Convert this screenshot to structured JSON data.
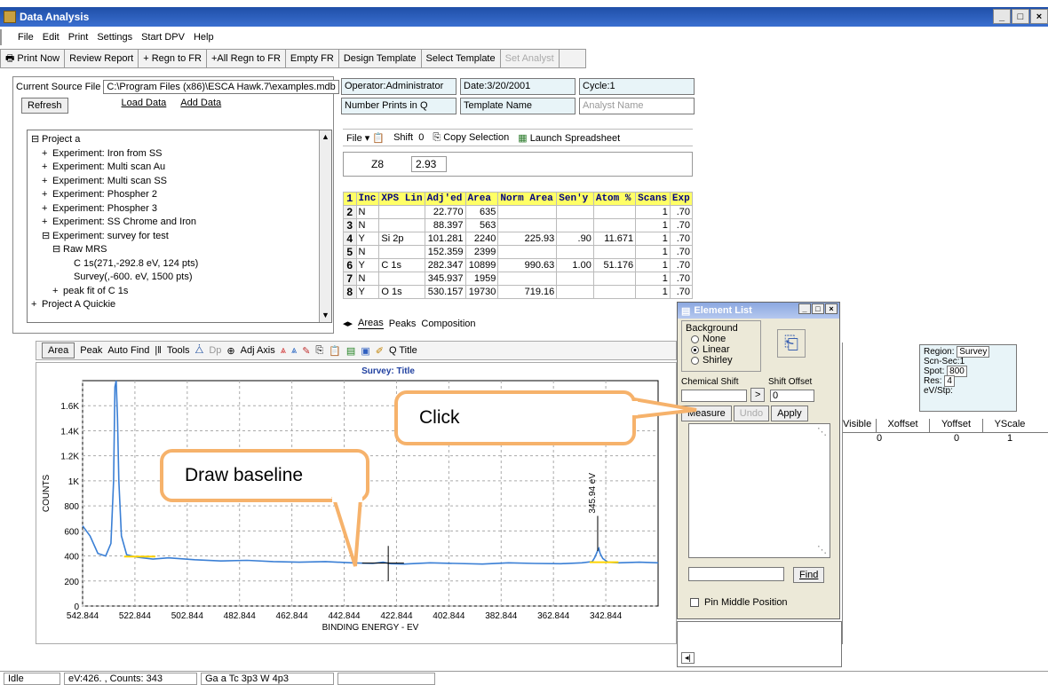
{
  "window": {
    "title": "Data Analysis",
    "controls": [
      "_",
      "□",
      "×"
    ]
  },
  "menu": [
    "File",
    "Edit",
    "Print",
    "Settings",
    "Start DPV",
    "Help"
  ],
  "toolbar": [
    {
      "label": "Print Now",
      "icon": "printer-icon",
      "disabled": false
    },
    {
      "label": "Review Report",
      "disabled": false
    },
    {
      "label": "+ Regn to FR",
      "disabled": false
    },
    {
      "label": "+All Regn to FR",
      "disabled": false
    },
    {
      "label": "Empty FR",
      "disabled": false
    },
    {
      "label": "Design Template",
      "disabled": false
    },
    {
      "label": "Select Template",
      "disabled": false
    },
    {
      "label": "Set Analyst",
      "disabled": true
    }
  ],
  "source": {
    "label": "Current Source File",
    "path": "C:\\Program Files (x86)\\ESCA Hawk.7\\examples.mdb",
    "refresh": "Refresh",
    "load": "Load Data",
    "add": "Add Data"
  },
  "info": {
    "operator": "Operator:Administrator",
    "date": "Date:3/20/2001",
    "cycle": "Cycle:1",
    "prints": "Number Prints in Q",
    "template": "Template Name",
    "analyst": "Analyst Name"
  },
  "tree": [
    {
      "indent": 0,
      "sign": "⊟",
      "text": "Project a"
    },
    {
      "indent": 1,
      "sign": "+",
      "text": "Experiment: Iron from SS"
    },
    {
      "indent": 1,
      "sign": "+",
      "text": "Experiment: Multi scan Au"
    },
    {
      "indent": 1,
      "sign": "+",
      "text": "Experiment: Multi scan SS"
    },
    {
      "indent": 1,
      "sign": "+",
      "text": "Experiment: Phospher 2"
    },
    {
      "indent": 1,
      "sign": "+",
      "text": "Experiment: Phospher 3"
    },
    {
      "indent": 1,
      "sign": "+",
      "text": "Experiment: SS Chrome and Iron"
    },
    {
      "indent": 1,
      "sign": "⊟",
      "text": "Experiment: survey for test"
    },
    {
      "indent": 2,
      "sign": "⊟",
      "text": "Raw MRS"
    },
    {
      "indent": 3,
      "sign": "",
      "text": "C 1s(271,-292.8 eV, 124 pts)"
    },
    {
      "indent": 3,
      "sign": "",
      "text": "Survey(,-600. eV, 1500 pts)"
    },
    {
      "indent": 2,
      "sign": "+",
      "text": "peak fit of C 1s"
    },
    {
      "indent": 0,
      "sign": "+",
      "text": "Project A Quickie"
    }
  ],
  "sheet_toolbar": {
    "file": "File",
    "shift": "Shift",
    "shift_val": "0",
    "copy": "Copy Selection",
    "launch": "Launch Spreadsheet"
  },
  "cell": {
    "ref": "Z8",
    "value": "2.93"
  },
  "sheet": {
    "headers": [
      "Inc",
      "XPS Lin",
      "Adj'ed",
      "Area",
      "Norm Area",
      "Sen'y",
      "Atom %",
      "Scans",
      "Exp"
    ],
    "rows": [
      {
        "n": "2",
        "c": [
          "N",
          "",
          "22.770",
          "635",
          "",
          "",
          "",
          "1",
          ".70"
        ]
      },
      {
        "n": "3",
        "c": [
          "N",
          "",
          "88.397",
          "563",
          "",
          "",
          "",
          "1",
          ".70"
        ]
      },
      {
        "n": "4",
        "c": [
          "Y",
          "Si 2p",
          "101.281",
          "2240",
          "225.93",
          ".90",
          "11.671",
          "1",
          ".70"
        ]
      },
      {
        "n": "5",
        "c": [
          "N",
          "",
          "152.359",
          "2399",
          "",
          "",
          "",
          "1",
          ".70"
        ]
      },
      {
        "n": "6",
        "c": [
          "Y",
          "C 1s",
          "282.347",
          "10899",
          "990.63",
          "1.00",
          "51.176",
          "1",
          ".70"
        ]
      },
      {
        "n": "7",
        "c": [
          "N",
          "",
          "345.937",
          "1959",
          "",
          "",
          "",
          "1",
          ".70"
        ]
      },
      {
        "n": "8",
        "c": [
          "Y",
          "O 1s",
          "530.157",
          "19730",
          "719.16",
          "",
          "",
          "1",
          ".70"
        ]
      }
    ]
  },
  "tabs": [
    "Areas",
    "Peaks",
    "Composition"
  ],
  "chart_toolbar": [
    "Area",
    "Peak",
    "Auto Find",
    "Tools",
    "Dp",
    "Adj Axis",
    "Q Title"
  ],
  "chart_data": {
    "type": "line",
    "title": "Survey:  Title",
    "xlabel": "BINDING ENERGY - EV",
    "ylabel": "COUNTS",
    "xlim": [
      542.844,
      322.844
    ],
    "ylim": [
      0,
      1800
    ],
    "xticks": [
      "542.844",
      "522.844",
      "502.844",
      "482.844",
      "462.844",
      "442.844",
      "422.844",
      "402.844",
      "382.844",
      "362.844",
      "342.844"
    ],
    "yticks": [
      "0",
      "200",
      "400",
      "600",
      "800",
      "1K",
      "1.2K",
      "1.4K",
      "1.6K"
    ],
    "annotation": "345.94 eV",
    "series": [
      {
        "x": [
          542.8,
          540,
          537,
          534,
          532,
          531,
          530.5,
          530,
          529.5,
          529,
          528,
          526,
          522,
          516,
          510,
          500,
          490,
          480,
          470,
          460,
          450,
          440,
          432,
          428,
          425,
          420,
          410,
          400,
          390,
          380,
          370,
          360,
          352,
          348,
          347,
          346,
          345.5,
          345,
          344,
          342,
          338,
          330,
          322.8
        ],
        "y": [
          640,
          560,
          420,
          400,
          500,
          1000,
          1750,
          1800,
          1500,
          1000,
          560,
          410,
          390,
          375,
          385,
          370,
          360,
          365,
          355,
          350,
          355,
          345,
          340,
          350,
          338,
          335,
          345,
          340,
          335,
          345,
          340,
          338,
          345,
          355,
          390,
          440,
          460,
          420,
          380,
          350,
          345,
          350,
          345
        ]
      }
    ]
  },
  "element_list": {
    "title": "Element List",
    "background": "Background",
    "options": [
      "None",
      "Linear",
      "Shirley"
    ],
    "selected": "Linear",
    "chem_shift": "Chemical Shift",
    "shift_offset": "Shift Offset",
    "offset_value": "0",
    "arrow": ">",
    "measure": "Measure",
    "undo": "Undo",
    "apply": "Apply",
    "find": "Find",
    "pin": "Pin Middle Position"
  },
  "region": {
    "region_label": "Region:",
    "region_val": "Survey",
    "scn_label": "Scn-Sec:",
    "scn_val": "1",
    "spot_label": "Spot:",
    "spot_val": "800",
    "res_label": "Res:",
    "res_val": "4",
    "evstp_label": "eV/Stp:",
    "cols": [
      "Visible",
      "Xoffset",
      "Yoffset",
      "YScale"
    ],
    "vals": [
      "",
      "0",
      "0",
      "1"
    ]
  },
  "callouts": {
    "click": "Click",
    "baseline": "Draw baseline"
  },
  "status": [
    "Idle",
    "eV:426. , Counts: 343",
    "Ga a  Tc 3p3  W 4p3"
  ],
  "colors": {
    "title": "#1f4fa8",
    "trace": "#3a7fd5",
    "baseline": "#ffd400",
    "callout": "#f6b26b",
    "header": "#ffff66"
  }
}
